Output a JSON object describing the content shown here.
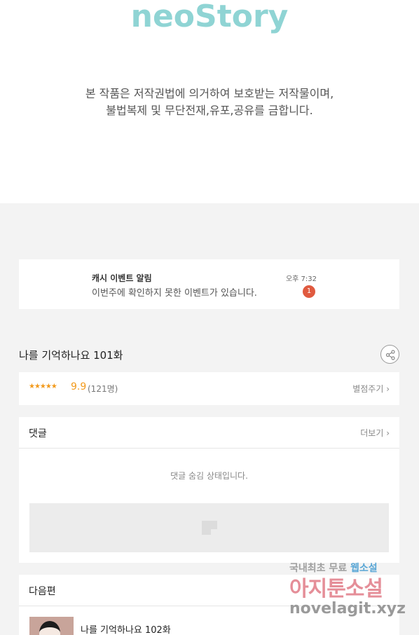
{
  "header": {
    "logo": "neoStory",
    "notice_line1": "본 작품은 저작권법에 의거하여 보호받는 저작물이며,",
    "notice_line2": "불법복제 및 무단전재,유포,공유를 금합니다."
  },
  "event": {
    "title": "캐시 이벤트 알림",
    "text": "이번주에 확인하지 못한 이벤트가 있습니다.",
    "time": "오후 7:32",
    "badge": "1"
  },
  "episode": {
    "title": "나를 기억하나요 101화",
    "share_icon": "share-icon"
  },
  "rating": {
    "stars": "★★★★★",
    "score": "9.9",
    "count": "(121명)",
    "rate_label": "별점주기 ›"
  },
  "comments": {
    "title": "댓글",
    "more_label": "더보기 ›",
    "hidden_message": "댓글 숨김 상태입니다."
  },
  "next": {
    "title": "다음편",
    "episode_title": "나를 기억하나요 102화"
  },
  "watermark": {
    "line1a": "국내최초 무료 ",
    "line1b": "웹소설",
    "line2": "아지툰소설",
    "line3": "novelagit.xyz"
  },
  "colors": {
    "accent_orange": "#f29a1c",
    "badge_red": "#e05a3f",
    "logo_teal": "#8fd4d4"
  }
}
